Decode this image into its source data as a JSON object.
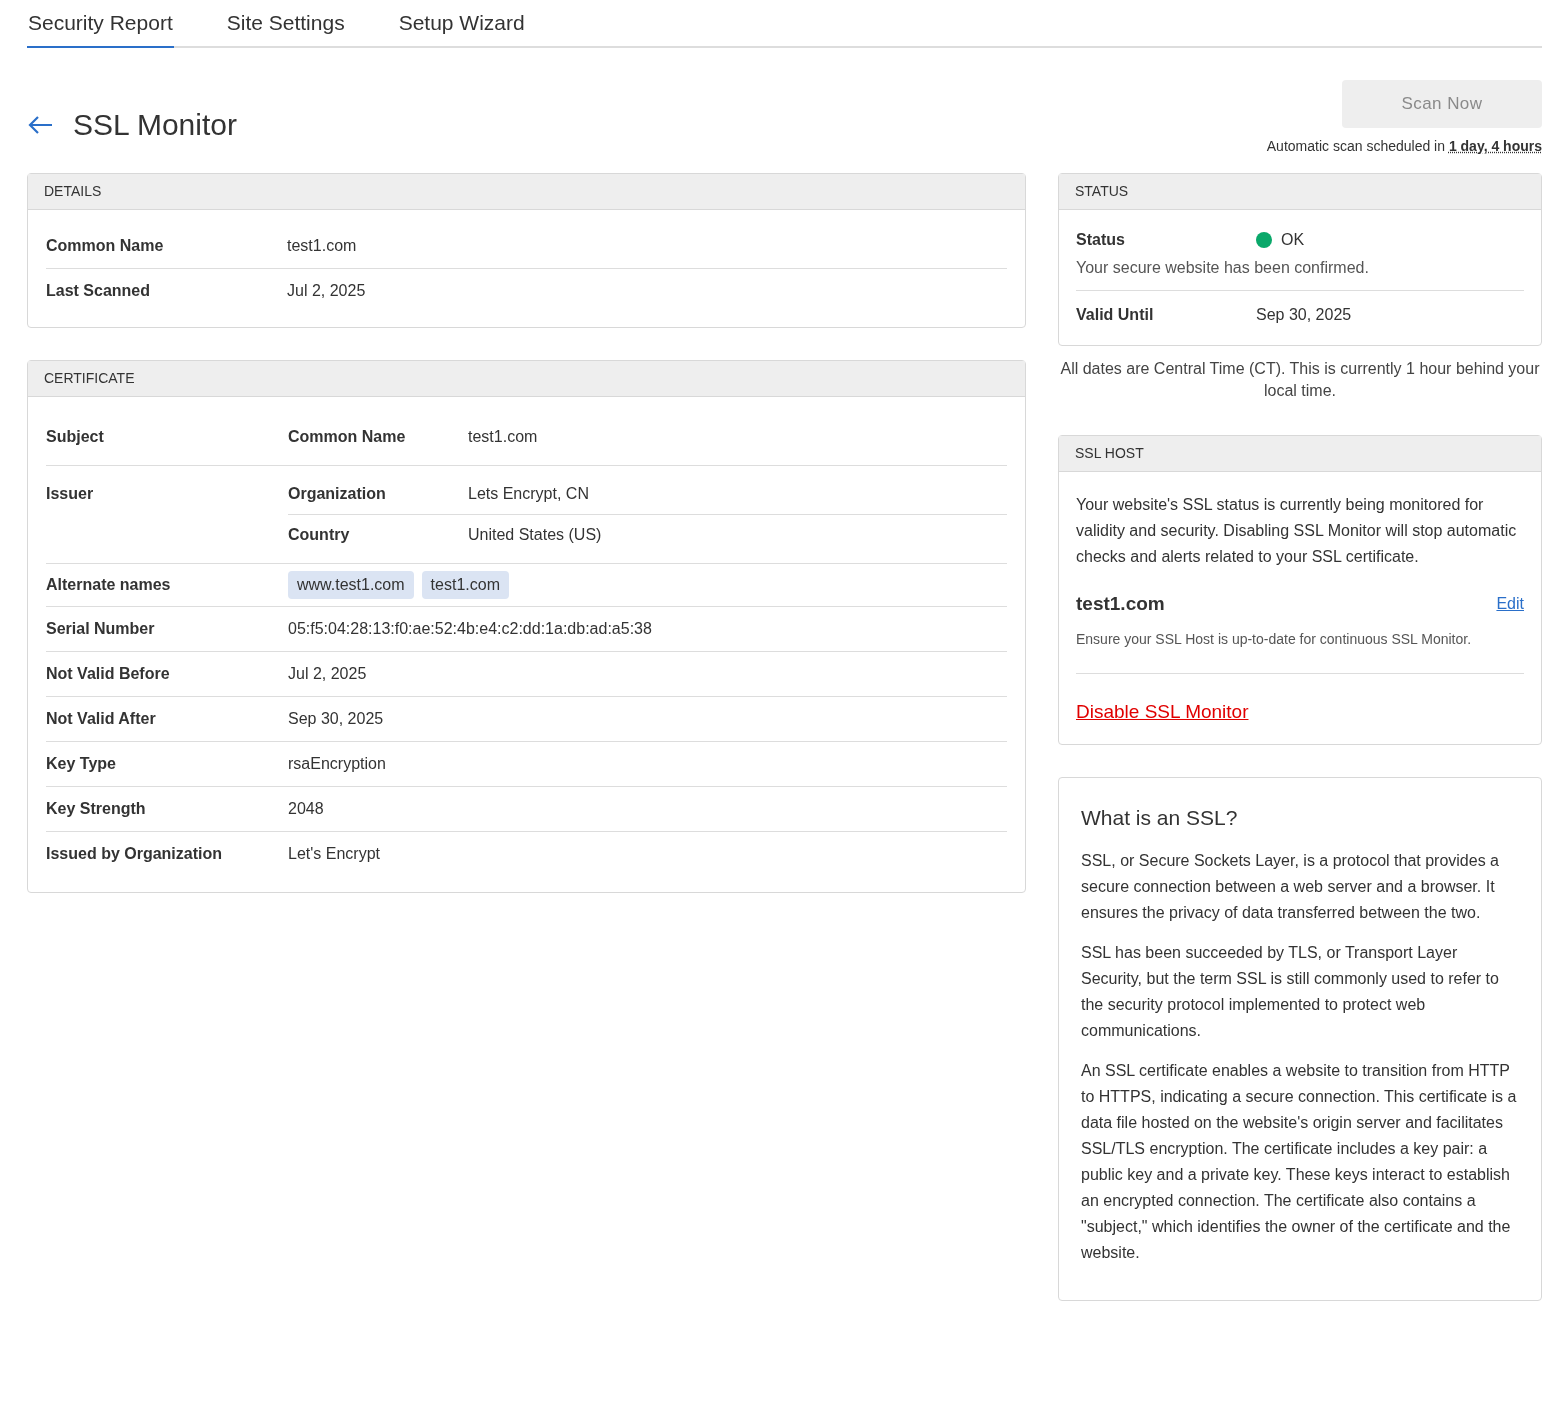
{
  "tabs": [
    {
      "label": "Security Report",
      "selected": true
    },
    {
      "label": "Site Settings",
      "selected": false
    },
    {
      "label": "Setup Wizard",
      "selected": false
    }
  ],
  "page": {
    "title": "SSL Monitor"
  },
  "scan": {
    "button": "Scan Now",
    "disabled": true,
    "note": "Automatic scan scheduled in",
    "eta": "1 day, 4 hours"
  },
  "details": {
    "title": "DETAILS",
    "rows": [
      {
        "label": "Common Name",
        "value": "test1.com"
      },
      {
        "label": "Last Scanned",
        "value": "Jul 2, 2025"
      }
    ]
  },
  "certificate": {
    "title": "CERTIFICATE",
    "rows": [
      {
        "kind": "nested",
        "label": "Subject",
        "items": [
          {
            "label": "Common Name",
            "value": "test1.com"
          }
        ]
      },
      {
        "kind": "nested",
        "label": "Issuer",
        "items": [
          {
            "label": "Organization",
            "value": "Lets Encrypt, CN"
          },
          {
            "label": "Country",
            "value": "United States (US)"
          }
        ]
      },
      {
        "kind": "tags",
        "label": "Alternate names",
        "tags": [
          "www.test1.com",
          "test1.com"
        ]
      },
      {
        "kind": "simple",
        "label": "Serial Number",
        "value": "05:f5:04:28:13:f0:ae:52:4b:e4:c2:dd:1a:db:ad:a5:38"
      },
      {
        "kind": "simple",
        "label": "Not Valid Before",
        "value": "Jul 2, 2025"
      },
      {
        "kind": "simple",
        "label": "Not Valid After",
        "value": "Sep 30, 2025"
      },
      {
        "kind": "simple",
        "label": "Key Type",
        "value": "rsaEncryption"
      },
      {
        "kind": "simple",
        "label": "Key Strength",
        "value": "2048"
      },
      {
        "kind": "simple",
        "label": "Issued by Organization",
        "value": "Let's Encrypt"
      }
    ]
  },
  "status": {
    "title": "STATUS",
    "label": "Status",
    "value": "OK",
    "color": "#0aa86a",
    "description": "Your secure website has been confirmed.",
    "valid_label": "Valid Until",
    "valid_value": "Sep 30, 2025"
  },
  "timezone_note": "All dates are Central Time (CT). This is currently 1 hour behind your local time.",
  "ssl_host": {
    "title": "SSL HOST",
    "description": "Your website's SSL status is currently being monitored for validity and security. Disabling SSL Monitor will stop automatic checks and alerts related to your SSL certificate.",
    "host": "test1.com",
    "edit": "Edit",
    "hint": "Ensure your SSL Host is up-to-date for continuous SSL Monitor.",
    "disable": "Disable SSL Monitor"
  },
  "info": {
    "title": "What is an SSL?",
    "paragraphs": [
      "SSL, or Secure Sockets Layer, is a protocol that provides a secure connection between a web server and a browser. It ensures the privacy of data transferred between the two.",
      "SSL has been succeeded by TLS, or Transport Layer Security, but the term SSL is still commonly used to refer to the security protocol implemented to protect web communications.",
      "An SSL certificate enables a website to transition from HTTP to HTTPS, indicating a secure connection. This certificate is a data file hosted on the website's origin server and facilitates SSL/TLS encryption. The certificate includes a key pair: a public key and a private key. These keys interact to establish an encrypted connection. The certificate also contains a \"subject,\" which identifies the owner of the certificate and the website."
    ]
  }
}
